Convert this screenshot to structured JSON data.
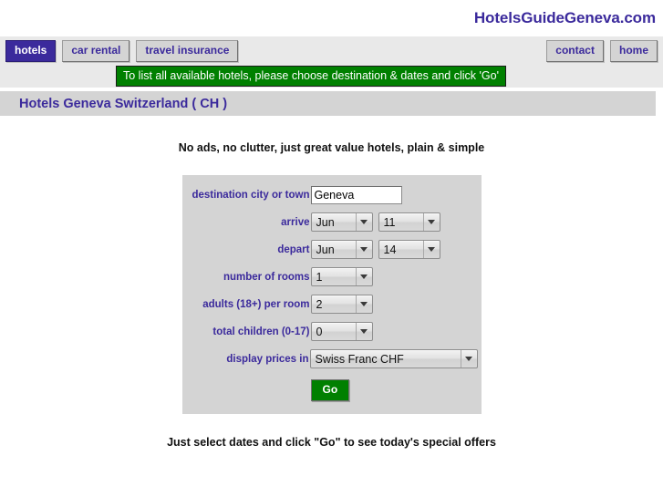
{
  "brand": {
    "name": "HotelsGuideGeneva.com"
  },
  "nav": {
    "left_tabs": [
      {
        "label": "hotels",
        "active": true
      },
      {
        "label": "car rental",
        "active": false
      },
      {
        "label": "travel insurance",
        "active": false
      }
    ],
    "right_tabs": [
      {
        "label": "contact"
      },
      {
        "label": "home"
      }
    ]
  },
  "notice": {
    "text": "To list all available hotels, please choose destination & dates and click 'Go'"
  },
  "page": {
    "title": "Hotels Geneva Switzerland ( CH )",
    "tagline": "No ads, no clutter, just great value hotels, plain & simple",
    "footer_note": "Just select dates and click \"Go\" to see today's special offers"
  },
  "form": {
    "destination": {
      "label": "destination city or town",
      "value": "Geneva",
      "placeholder": ""
    },
    "arrive": {
      "label": "arrive",
      "month": "Jun",
      "day": "11"
    },
    "depart": {
      "label": "depart",
      "month": "Jun",
      "day": "14"
    },
    "rooms": {
      "label": "number of rooms",
      "value": "1"
    },
    "adults": {
      "label": "adults (18+) per room",
      "value": "2"
    },
    "children": {
      "label": "total children (0-17)",
      "value": "0"
    },
    "currency": {
      "label": "display prices in",
      "value": "Swiss Franc CHF"
    },
    "submit": {
      "label": "Go"
    }
  },
  "colors": {
    "brand_purple": "#3b2a9c",
    "banner_green": "#008000",
    "band_gray": "#d4d4d4",
    "nav_gray": "#e9e9e9"
  }
}
